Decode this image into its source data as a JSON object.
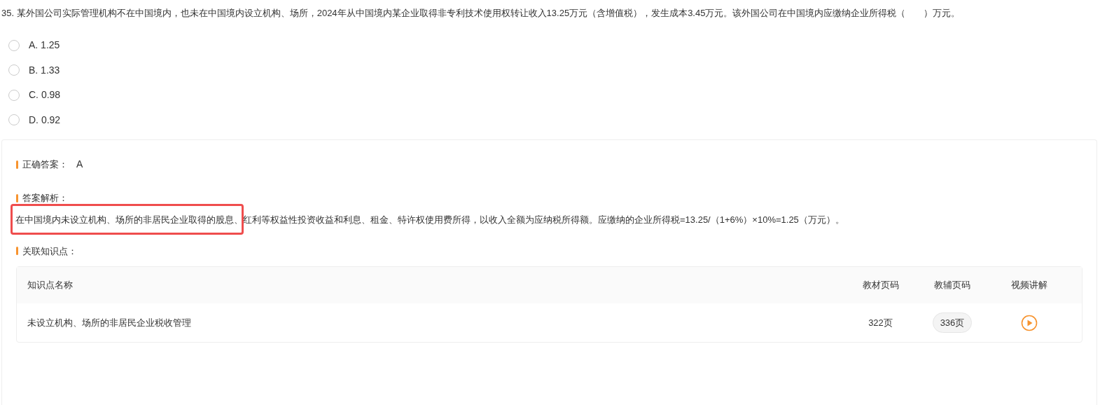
{
  "question": {
    "text": "35. 某外国公司实际管理机构不在中国境内，也未在中国境内设立机构、场所，2024年从中国境内某企业取得非专利技术使用权转让收入13.25万元（含增值税），发生成本3.45万元。该外国公司在中国境内应缴纳企业所得税（　　）万元。",
    "options": [
      {
        "label": "A. 1.25",
        "selected": false
      },
      {
        "label": "B. 1.33",
        "selected": false
      },
      {
        "label": "C. 0.98",
        "selected": false
      },
      {
        "label": "D. 0.92",
        "selected": false
      }
    ]
  },
  "answer": {
    "label": "正确答案：",
    "value": "A"
  },
  "analysis": {
    "label": "答案解析：",
    "text": "在中国境内未设立机构、场所的非居民企业取得的股息、红利等权益性投资收益和利息、租金、特许权使用费所得，以收入全额为应纳税所得额。应缴纳的企业所得税=13.25/（1+6%）×10%=1.25（万元）。",
    "highlighted": true
  },
  "knowledge": {
    "label": "关联知识点：",
    "table": {
      "columns": [
        "知识点名称",
        "教材页码",
        "教辅页码",
        "视频讲解"
      ],
      "rows": [
        {
          "name": "未设立机构、场所的非居民企业税收管理",
          "textbook_page": "322页",
          "guide_page": "336页"
        }
      ]
    }
  }
}
